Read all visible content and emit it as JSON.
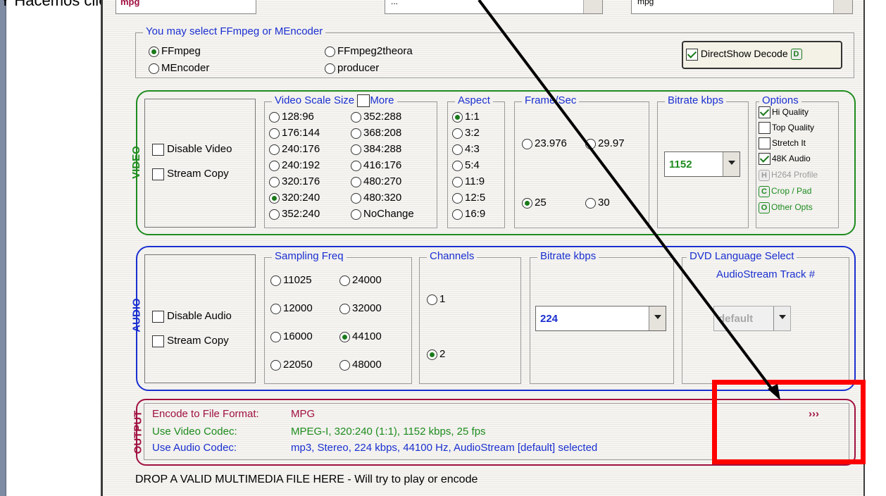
{
  "header": {
    "text": "Y Hacemos clic con el botón derecho sobre",
    "arrows": "› › ›"
  },
  "top_combos": {
    "codec_value": "mpg",
    "middle_value": "...",
    "right_value": "mpg"
  },
  "encoder": {
    "legend": "You may select FFmpeg or MEncoder",
    "options": [
      {
        "label": "FFmpeg",
        "selected": true
      },
      {
        "label": "FFmpeg2theora",
        "selected": false
      },
      {
        "label": "MEncoder",
        "selected": false
      },
      {
        "label": "producer",
        "selected": false
      }
    ],
    "directshow": {
      "label": "DirectShow Decode",
      "key": "D",
      "checked": true
    }
  },
  "video": {
    "title": "VIDEO",
    "disable": "Disable Video",
    "stream_copy": "Stream Copy",
    "scale_legend": "Video Scale Size",
    "more": "More",
    "sizes_col1": [
      "128:96",
      "176:144",
      "240:176",
      "240:192",
      "320:176",
      "320:240",
      "352:240"
    ],
    "sizes_col2": [
      "352:288",
      "368:208",
      "384:288",
      "416:176",
      "480:270",
      "480:320",
      "NoChange"
    ],
    "selected_size": "320:240",
    "aspect_legend": "Aspect",
    "aspects": [
      "1:1",
      "3:2",
      "4:3",
      "5:4",
      "11:9",
      "12:5",
      "16:9"
    ],
    "selected_aspect": "1:1",
    "fps_legend": "Frame/Sec",
    "fps": [
      "23.976",
      "29.97",
      "25",
      "30"
    ],
    "selected_fps": "25",
    "bitrate_legend": "Bitrate  kbps",
    "bitrate": "1152",
    "options_legend": "Options",
    "options": [
      {
        "label": "Hi Quality",
        "checked": true
      },
      {
        "label": "Top Quality",
        "checked": false
      },
      {
        "label": "Stretch It",
        "checked": false
      },
      {
        "label": "48K Audio",
        "checked": true
      }
    ],
    "buttons": [
      {
        "key": "H",
        "label": "H264 Profile",
        "disabled": true
      },
      {
        "key": "C",
        "label": "Crop / Pad",
        "disabled": false
      },
      {
        "key": "O",
        "label": "Other Opts",
        "disabled": false
      }
    ],
    "color": "#1e8c1e"
  },
  "audio": {
    "title": "AUDIO",
    "disable": "Disable Audio",
    "stream_copy": "Stream Copy",
    "freq_legend": "Sampling Freq",
    "freqs": [
      "11025",
      "24000",
      "12000",
      "32000",
      "16000",
      "44100",
      "22050",
      "48000"
    ],
    "selected_freq": "44100",
    "channels_legend": "Channels",
    "channels": [
      "1",
      "2"
    ],
    "selected_channel": "2",
    "bitrate_legend": "Bitrate  kbps",
    "bitrate": "224",
    "dvd_legend": "DVD Language Select",
    "dvd_sub": "AudioStream  Track #",
    "dvd_value": "default",
    "color": "#1a2fd0"
  },
  "output": {
    "title": "OUTPUT",
    "format_label": "Encode to File Format:",
    "format_value": "MPG",
    "video_label": "Use Video Codec:",
    "video_value": "MPEG-I,  320:240 (1:1),  1152 kbps,  25 fps",
    "audio_label": "Use Audio Codec:",
    "audio_value": "mp3,  Stereo,  224 kbps,  44100 Hz,  AudioStream [default] selected",
    "more": "›››",
    "color": "#a01040"
  },
  "drop_hint": "DROP A VALID MULTIMEDIA FILE HERE - Will try to play or encode",
  "annotation": {
    "highlight_color": "#ff0000",
    "arrow_color": "#000000"
  }
}
